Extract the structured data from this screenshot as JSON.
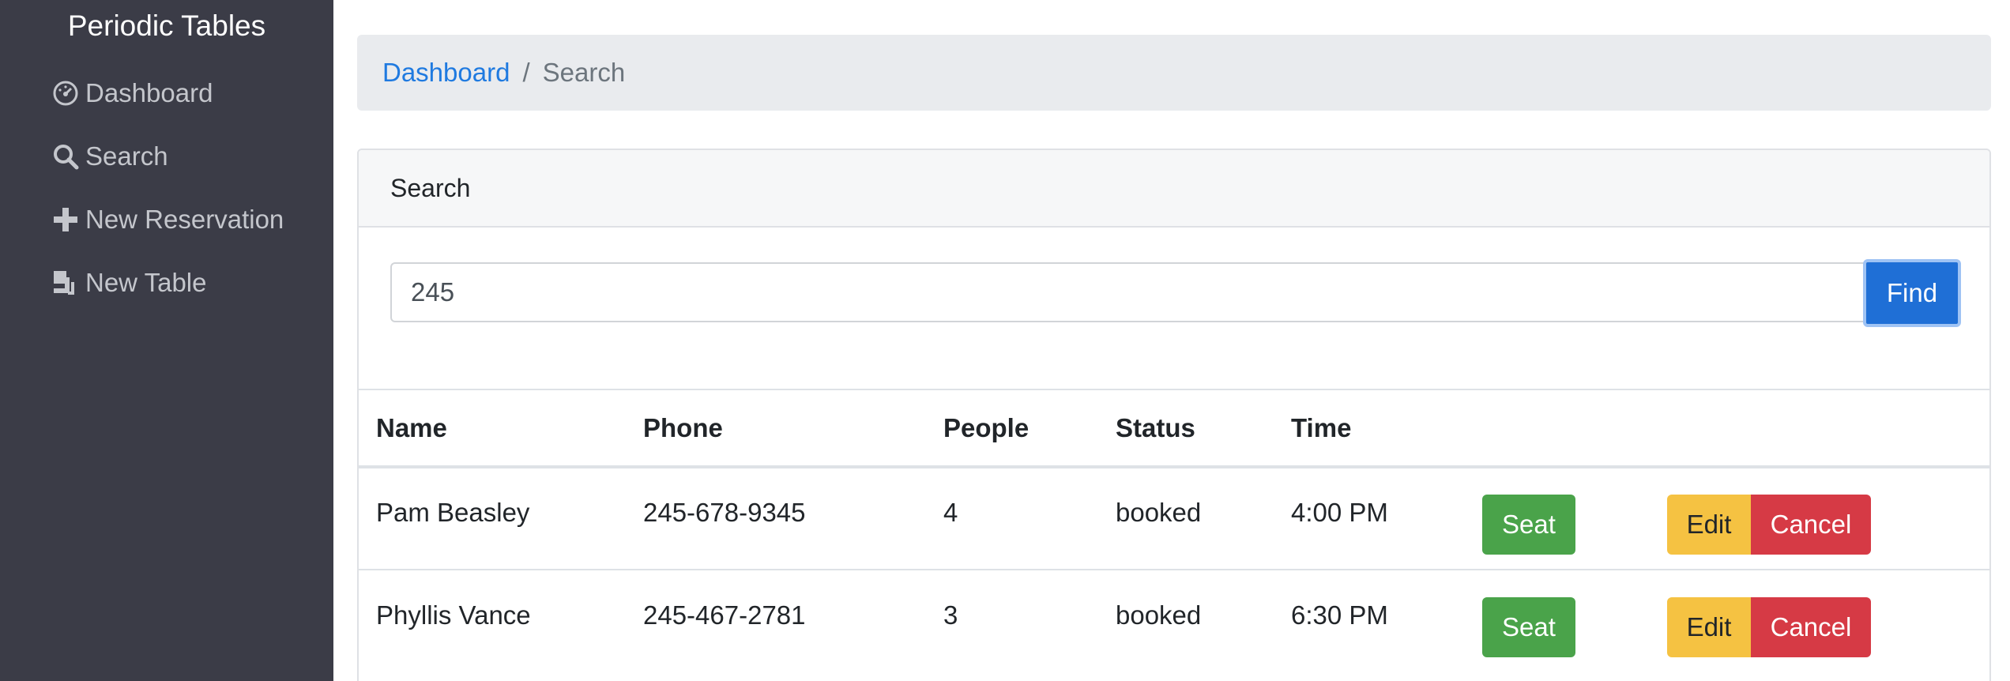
{
  "sidebar": {
    "brand": "Periodic Tables",
    "items": [
      {
        "label": "Dashboard",
        "icon": "dashboard-icon"
      },
      {
        "label": "Search",
        "icon": "search-icon"
      },
      {
        "label": "New Reservation",
        "icon": "plus-icon"
      },
      {
        "label": "New Table",
        "icon": "table-icon"
      }
    ]
  },
  "breadcrumb": {
    "link": "Dashboard",
    "separator": "/",
    "current": "Search"
  },
  "search": {
    "header": "Search",
    "value": "245",
    "button": "Find"
  },
  "table": {
    "headers": [
      "Name",
      "Phone",
      "People",
      "Status",
      "Time"
    ],
    "rows": [
      {
        "name": "Pam Beasley",
        "phone": "245-678-9345",
        "people": "4",
        "status": "booked",
        "time": "4:00 PM",
        "seat": "Seat",
        "edit": "Edit",
        "cancel": "Cancel"
      },
      {
        "name": "Phyllis Vance",
        "phone": "245-467-2781",
        "people": "3",
        "status": "booked",
        "time": "6:30 PM",
        "seat": "Seat",
        "edit": "Edit",
        "cancel": "Cancel"
      }
    ]
  },
  "colors": {
    "sidebar_bg": "#3b3c47",
    "link": "#1f7ae0",
    "primary": "#1f6fd6",
    "success": "#4aa34a",
    "warning": "#f5c242",
    "danger": "#d63a45"
  }
}
